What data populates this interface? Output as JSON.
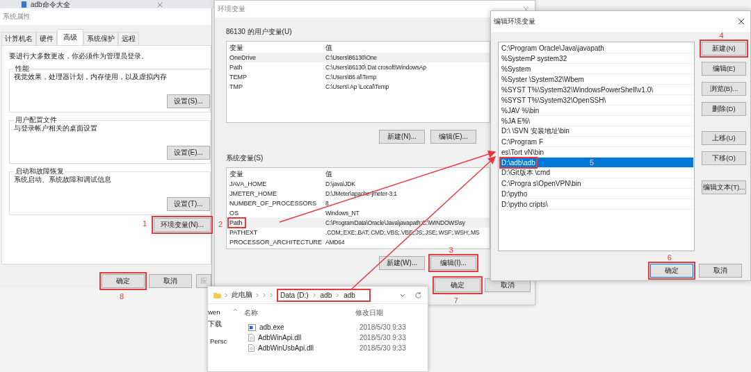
{
  "background_tab": {
    "title": "adb命令大全"
  },
  "system_properties": {
    "title": "系统属性",
    "tabs": [
      {
        "label": "计算机名",
        "selected": false
      },
      {
        "label": "硬件",
        "selected": false
      },
      {
        "label": "高级",
        "selected": true
      },
      {
        "label": "系统保护",
        "selected": false
      },
      {
        "label": "远程",
        "selected": false
      }
    ],
    "notice": "要进行大多数更改，你必须作为管理员登录。",
    "groups": [
      {
        "title": "性能",
        "description": "视觉效果，处理器计划，内存使用，以及虚拟内存",
        "button": "设置(S)..."
      },
      {
        "title": "用户配置文件",
        "description": "与登录帐户相关的桌面设置",
        "button": "设置(E)..."
      },
      {
        "title": "启动和故障恢复",
        "description": "系统启动、系统故障和调试信息",
        "button": "设置(T)..."
      }
    ],
    "env_button": {
      "label": "环境变量(N)...",
      "annotation": "1"
    },
    "buttons": [
      {
        "label": "确定",
        "disabled": false,
        "annotation": "8"
      },
      {
        "label": "取消",
        "disabled": false
      },
      {
        "label": "应",
        "disabled": true
      }
    ]
  },
  "environment_variables": {
    "title": "环境变量",
    "user_section": {
      "title": "86130 的用户变量(U)",
      "columns": [
        "变量",
        "值"
      ],
      "rows": [
        {
          "name": "OneDrive",
          "value": "C:\\Users\\86130\\One",
          "selected": true
        },
        {
          "name": "Path",
          "value": "C:\\Users\\86130\\ Dat crosoft\\WindowsAp",
          "selected": false
        },
        {
          "name": "TEMP",
          "value": "C:\\Users\\86 al\\Temp",
          "selected": false
        },
        {
          "name": "TMP",
          "value": "C:\\Users\\ Ap \\Local\\Temp",
          "selected": false
        }
      ],
      "buttons": [
        {
          "label": "新建(N)..."
        },
        {
          "label": "编辑(E)..."
        }
      ]
    },
    "system_section": {
      "title": "系统变量(S)",
      "columns": [
        "变量",
        "值"
      ],
      "rows": [
        {
          "name": "JAVA_HOME",
          "value": "D:\\java\\JDK",
          "selected": false
        },
        {
          "name": "JMETER_HOME",
          "value": "D:\\JMeter\\apache-jmeter-3.1",
          "selected": false
        },
        {
          "name": "NUMBER_OF_PROCESSORS",
          "value": "8",
          "selected": false
        },
        {
          "name": "OS",
          "value": "Windows_NT",
          "selected": false
        },
        {
          "name": "Path",
          "value": "C:\\ProgramData\\Oracle\\Java\\javapath;C:\\WINDOWS\\sy",
          "selected": true,
          "annotation": "2"
        },
        {
          "name": "PATHEXT",
          "value": ".COM;.EXE;.BAT;.CMD;.VBS;.VBE;.JS;.JSE;.WSF;.WSH;.MS",
          "selected": false
        },
        {
          "name": "PROCESSOR_ARCHITECTURE",
          "value": "AMD64",
          "selected": false
        }
      ],
      "buttons": [
        {
          "label": "新建(W)..."
        },
        {
          "label": "编辑(I)...",
          "annotation": "3"
        }
      ]
    },
    "buttons": [
      {
        "label": "确定",
        "annotation": "7"
      },
      {
        "label": "取消"
      }
    ]
  },
  "edit_environment_variable": {
    "title": "编辑环境变量",
    "entries": [
      {
        "text": "C:\\Program Oracle\\Java\\javapath",
        "selected": false
      },
      {
        "text": "%SystemP system32",
        "selected": false
      },
      {
        "text": "%System",
        "selected": false
      },
      {
        "text": "%Syster \\System32\\Wbem",
        "selected": false
      },
      {
        "text": "%SYST T%\\System32\\WindowsPowerShell\\v1.0\\",
        "selected": false
      },
      {
        "text": "%SYST T%\\System32\\OpenSSH\\",
        "selected": false
      },
      {
        "text": "%JAV %\\bin",
        "selected": false
      },
      {
        "text": "%JA E%\\",
        "selected": false
      },
      {
        "text": "D:\\ \\SVN 安装地址\\bin",
        "selected": false
      },
      {
        "text": "C:\\Program F",
        "selected": false
      },
      {
        "text": "es\\Tort vN\\bin",
        "selected": false
      },
      {
        "text": "D:\\adb\\adb",
        "selected": true,
        "annotation": "5"
      },
      {
        "text": "D:\\Git版本 \\cmd",
        "selected": false
      },
      {
        "text": "C:\\Progra s\\OpenVPN\\bin",
        "selected": false
      },
      {
        "text": "D:\\pytho",
        "selected": false
      },
      {
        "text": "D:\\pytho cripts\\",
        "selected": false
      }
    ],
    "side_button_groups": [
      [
        {
          "label": "新建(N)",
          "annotation": "4"
        },
        {
          "label": "编辑(E)"
        },
        {
          "label": "浏览(B)..."
        },
        {
          "label": "删除(D)"
        }
      ],
      [
        {
          "label": "上移(U)"
        },
        {
          "label": "下移(O)"
        }
      ],
      [
        {
          "label": "编辑文本(T)..."
        }
      ]
    ],
    "buttons": [
      {
        "label": "确定",
        "focused": true,
        "annotation": "6"
      },
      {
        "label": "取消",
        "focused": false
      }
    ]
  },
  "file_explorer": {
    "breadcrumb": [
      "此电脑",
      "Data (D:)",
      "adb",
      "adb"
    ],
    "nav_items": [
      "wen",
      "下载",
      "Persc"
    ],
    "columns": [
      "名称",
      "修改日期"
    ],
    "files": [
      {
        "name": "adb.exe",
        "date": "2018/5/30 9:33",
        "kind": "exe"
      },
      {
        "name": "AdbWinApi.dll",
        "date": "2018/5/30 9:33",
        "kind": "dll"
      },
      {
        "name": "AdbWinUsbApi.dll",
        "date": "2018/5/30 9:33",
        "kind": "dll"
      }
    ]
  }
}
